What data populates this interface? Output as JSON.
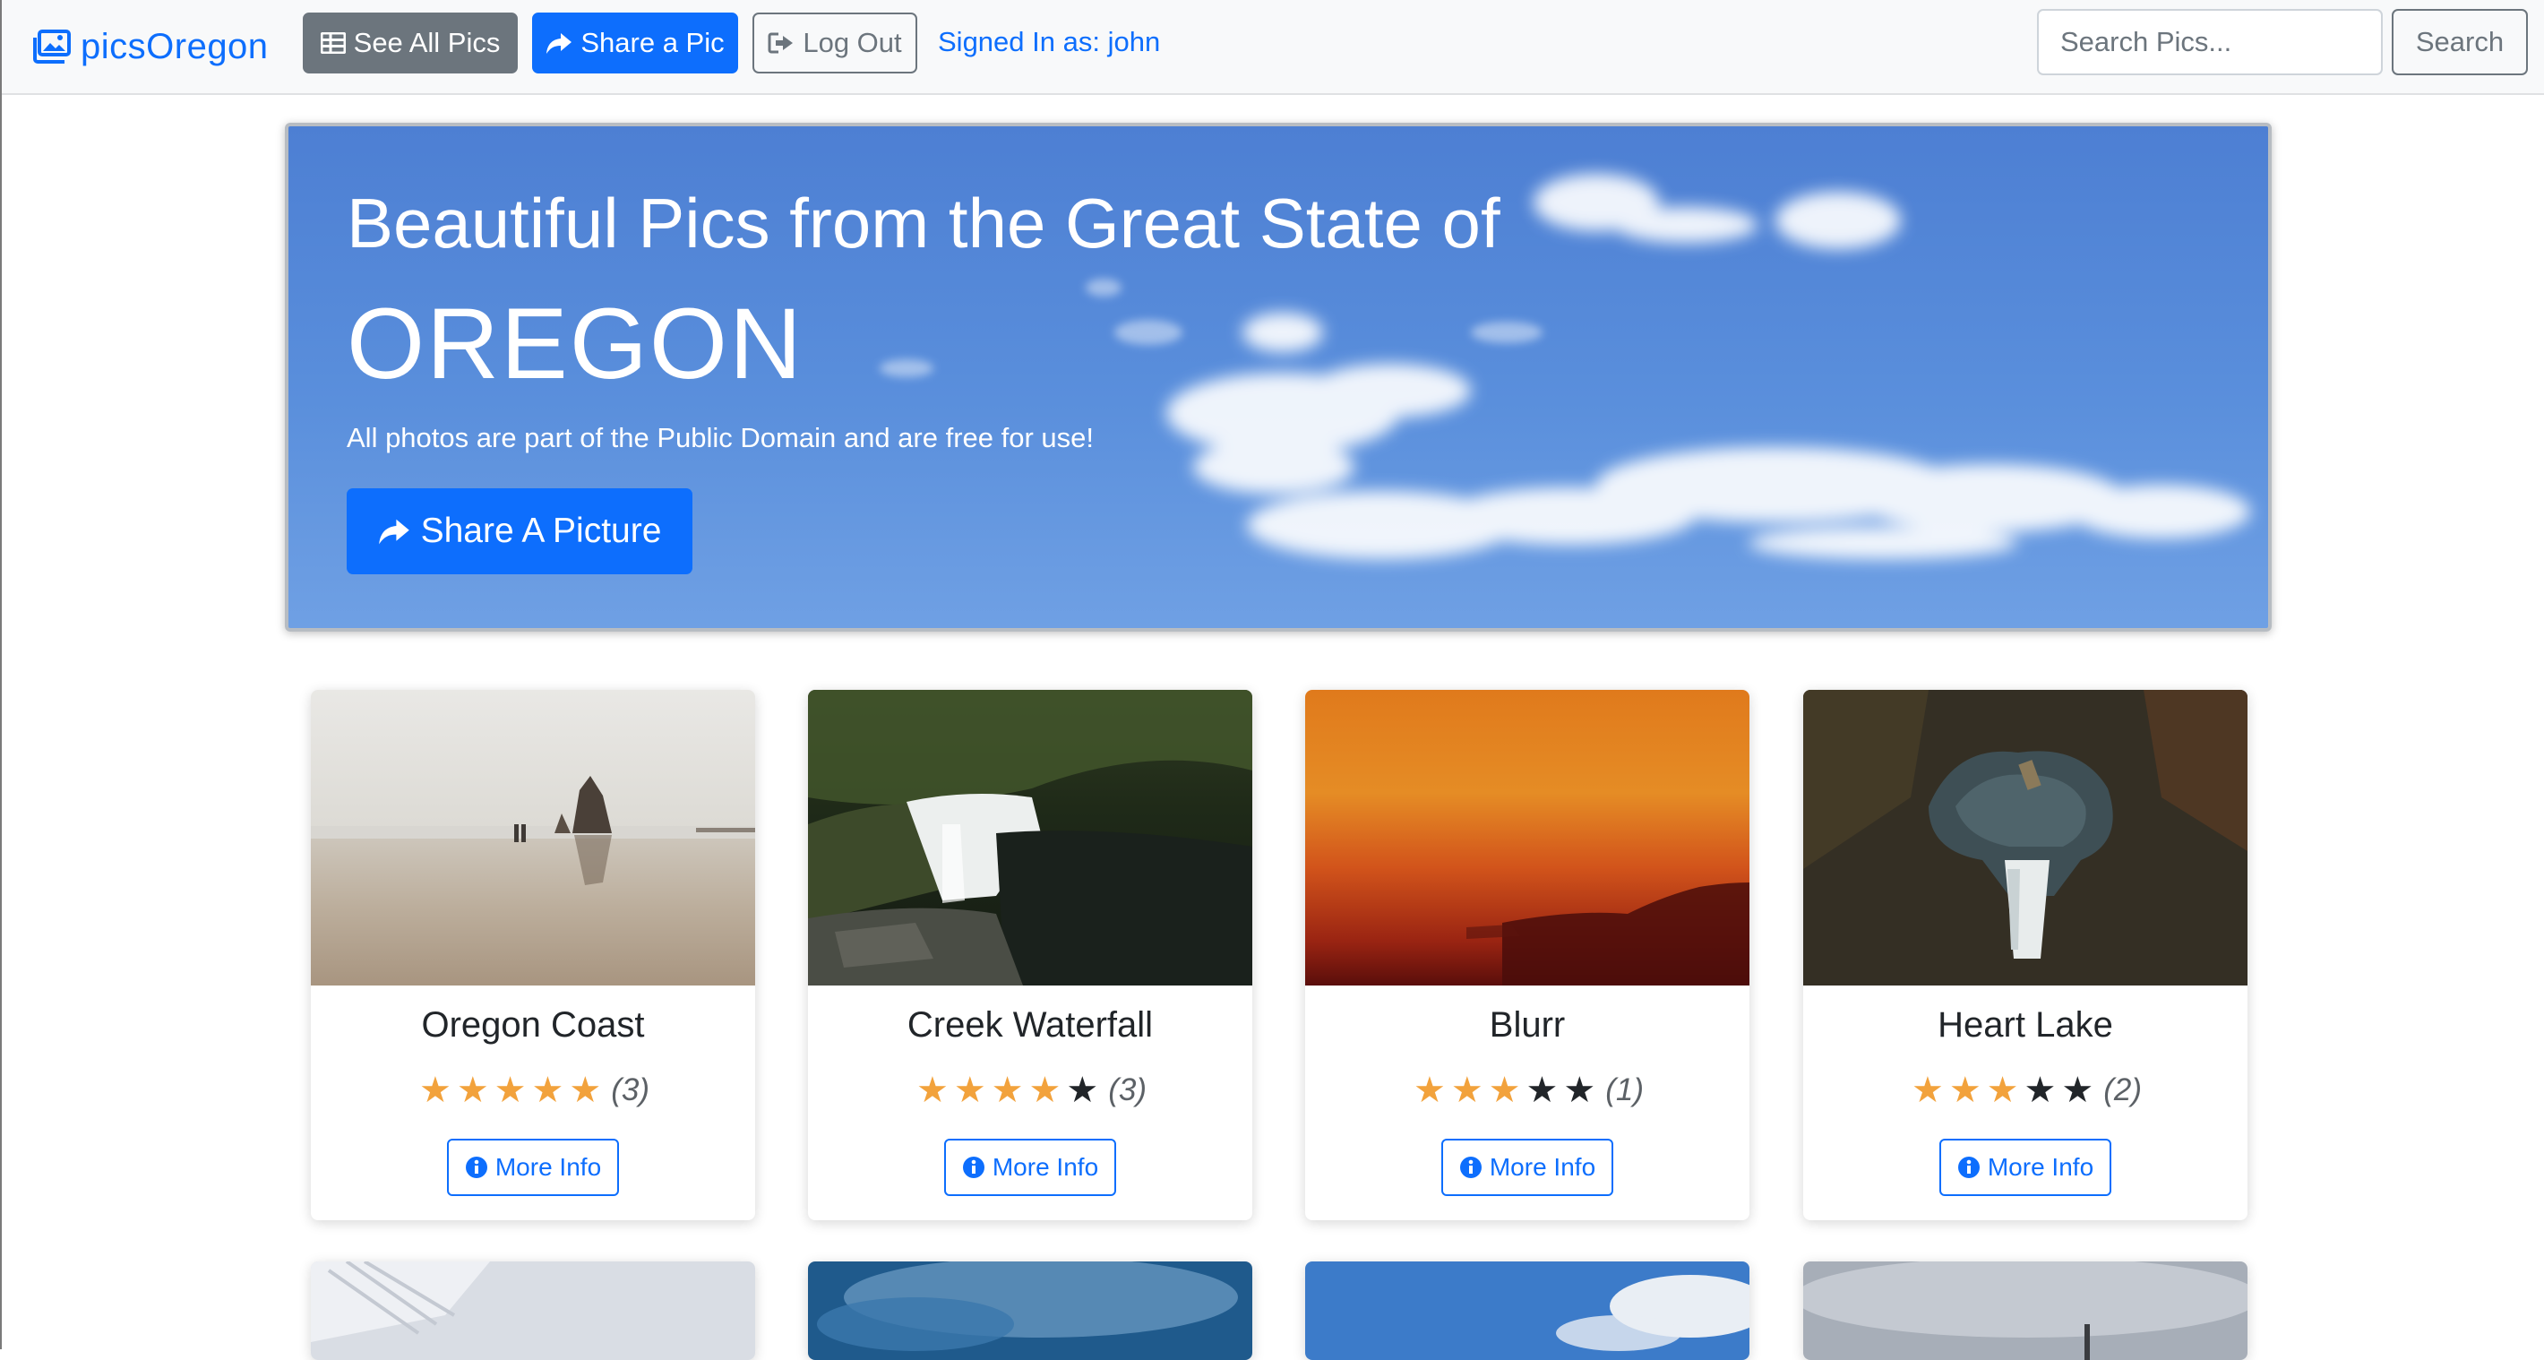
{
  "navbar": {
    "brand": "picsOregon",
    "see_all_label": "See All Pics",
    "share_label": "Share a Pic",
    "logout_label": "Log Out",
    "signed_in": "Signed In as: john",
    "search_placeholder": "Search Pics...",
    "search_button": "Search"
  },
  "hero": {
    "title": "Beautiful Pics from the Great State of",
    "big": "OREGON",
    "subtitle": "All photos are part of the Public Domain and are free for use!",
    "button": "Share A Picture"
  },
  "cards": [
    {
      "title": "Oregon Coast",
      "rating": 5,
      "max": 5,
      "count": "(3)",
      "button": "More Info",
      "image": "beach-sea-stack"
    },
    {
      "title": "Creek Waterfall",
      "rating": 4,
      "max": 5,
      "count": "(3)",
      "button": "More Info",
      "image": "forest-waterfall"
    },
    {
      "title": "Blurr",
      "rating": 3,
      "max": 5,
      "count": "(1)",
      "button": "More Info",
      "image": "orange-sunset"
    },
    {
      "title": "Heart Lake",
      "rating": 3,
      "max": 5,
      "count": "(2)",
      "button": "More Info",
      "image": "aerial-lake"
    }
  ],
  "icons": {
    "brand": "images-icon",
    "see_all": "grid-icon",
    "share": "share-icon",
    "logout": "sign-out-icon",
    "more_info": "info-circle-icon",
    "star": "star-icon"
  },
  "colors": {
    "primary": "#0d6efd",
    "secondary": "#6c757d",
    "star": "#f2a23c",
    "hero_sky": "#5a8fdc"
  }
}
